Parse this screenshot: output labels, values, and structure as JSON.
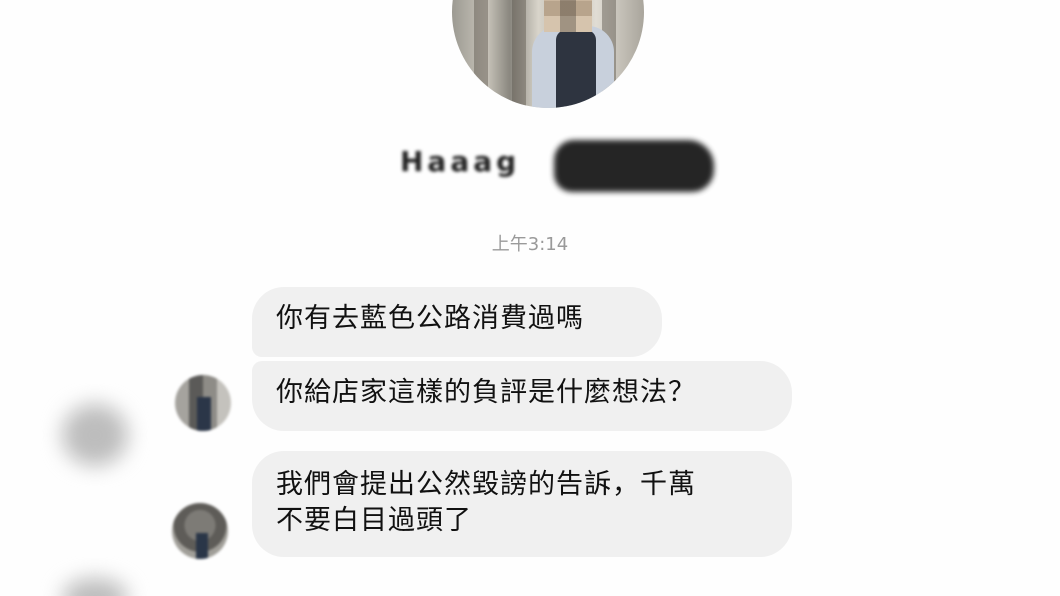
{
  "profile": {
    "name_visible": "Haaag",
    "photo": "profile-photo-pixelated"
  },
  "chat": {
    "timestamp": "上午3:14",
    "messages": [
      {
        "text": "你有去藍色公路消費過嗎"
      },
      {
        "text": "你給店家這樣的負評是什麼想法？"
      },
      {
        "line1": "我們會提出公然毀謗的告訴，千萬",
        "line2": "不要白目過頭了"
      }
    ]
  },
  "colors": {
    "bubble_bg": "#f0f0f0",
    "timestamp": "#9a9a9a",
    "background": "#ffffff"
  }
}
